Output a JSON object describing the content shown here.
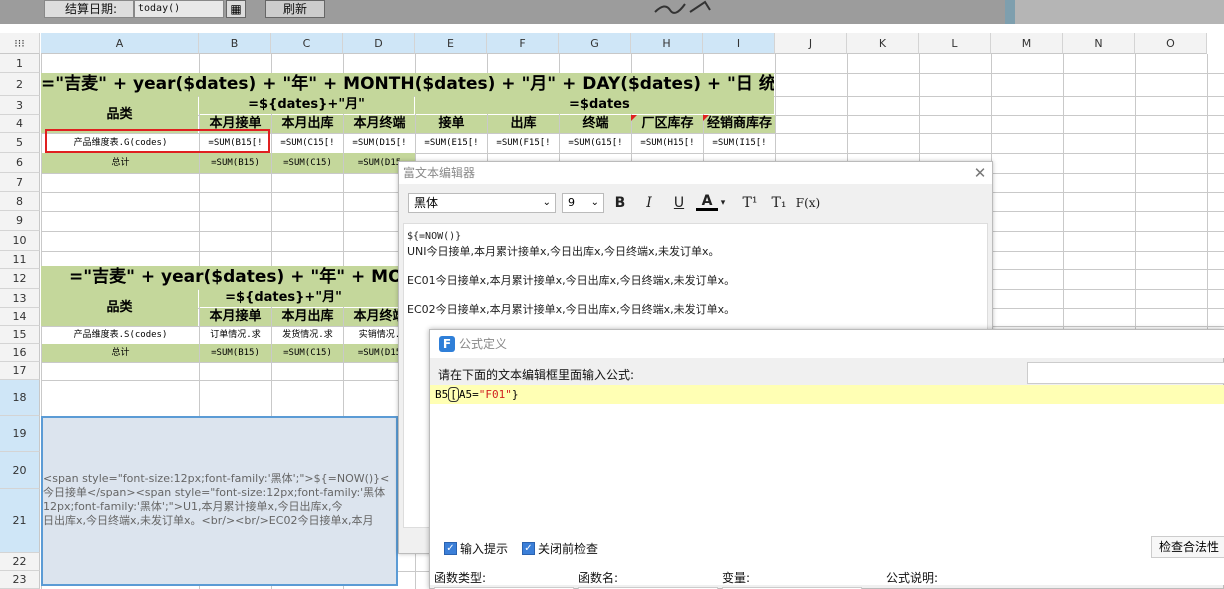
{
  "toolbar": {
    "settlement_date_label": "结算日期:",
    "settlement_date_value": "today()",
    "calendar_icon": "calendar-icon",
    "refresh_label": "刷新"
  },
  "columns": [
    "A",
    "B",
    "C",
    "D",
    "E",
    "F",
    "G",
    "H",
    "I",
    "J",
    "K",
    "L",
    "M",
    "N",
    "O"
  ],
  "rows": [
    "1",
    "2",
    "3",
    "4",
    "5",
    "6",
    "7",
    "8",
    "9",
    "10",
    "11",
    "12",
    "13",
    "14",
    "15",
    "16",
    "17",
    "18",
    "19",
    "20",
    "21",
    "22",
    "23"
  ],
  "sheet": {
    "title": "=\"吉麦\" + year($dates) + \"年\" + MONTH($dates) + \"月\" + DAY($dates) + \"日  统计表\"",
    "title2": "=\"吉麦\" + year($dates) + \"年\" + MONTH(",
    "category": "品类",
    "month_group": "=${dates}+\"月\"",
    "dates_group": "=$dates",
    "headers": [
      "本月接单",
      "本月出库",
      "本月终端",
      "接单",
      "出库",
      "终端",
      "厂区库存",
      "经销商库存"
    ],
    "headers2": [
      "本月接单",
      "本月出库",
      "本月终端"
    ],
    "row5": [
      "产品维度表.G(codes)",
      "=SUM(B15[!",
      "=SUM(C15[!",
      "=SUM(D15[!",
      "=SUM(E15[!",
      "=SUM(F15[!",
      "=SUM(G15[!",
      "=SUM(H15[!",
      "=SUM(I15[!"
    ],
    "row6": [
      "总计",
      "=SUM(B15)",
      "=SUM(C15)",
      "=SUM(D15"
    ],
    "row15": [
      "产品维度表.S(codes)",
      "订单情况.求",
      "发货情况.求",
      "实销情况."
    ],
    "row16": [
      "总计",
      "=SUM(B15)",
      "=SUM(C15)",
      "=SUM(D15"
    ],
    "merged_cell_lines": [
      "<span style=\"font-size:12px;font-family:'黑体';\">${=NOW()}<",
      "今日接单</span><span style=\"font-size:12px;font-family:'黑体",
      "12px;font-family:'黑体';\">U1,本月累计接单x,今日出库x,今",
      "日出库x,今日终端x,未发订单x。<br/><br/>EC02今日接单x,本月"
    ]
  },
  "rich_editor": {
    "title": "富文本编辑器",
    "font": "黑体",
    "size": "9",
    "bold": "B",
    "italic": "I",
    "underline": "U",
    "color": "A",
    "superscript": "T¹",
    "subscript": "T₁",
    "formula": "F(x)",
    "lines": [
      "${=NOW()}",
      "UNI今日接单,本月累计接单x,今日出库x,今日终端x,未发订单x。",
      "EC01今日接单x,本月累计接单x,今日出库x,今日终端x,未发订单x。",
      "EC02今日接单x,本月累计接单x,今日出库x,今日终端x,未发订单x。"
    ]
  },
  "formula_dialog": {
    "title": "公式定义",
    "prompt": "请在下面的文本编辑框里面输入公式:",
    "formula_prefix": "B5",
    "formula_bracket": "[",
    "formula_mid": "A5=",
    "formula_string": "\"F01\"",
    "formula_suffix": "}",
    "input_hint": "输入提示",
    "check_before_close": "关闭前检查",
    "check_validity": "检查合法性",
    "function_type": "函数类型:",
    "function_name": "函数名:",
    "variable": "变量:",
    "formula_desc": "公式说明:"
  }
}
